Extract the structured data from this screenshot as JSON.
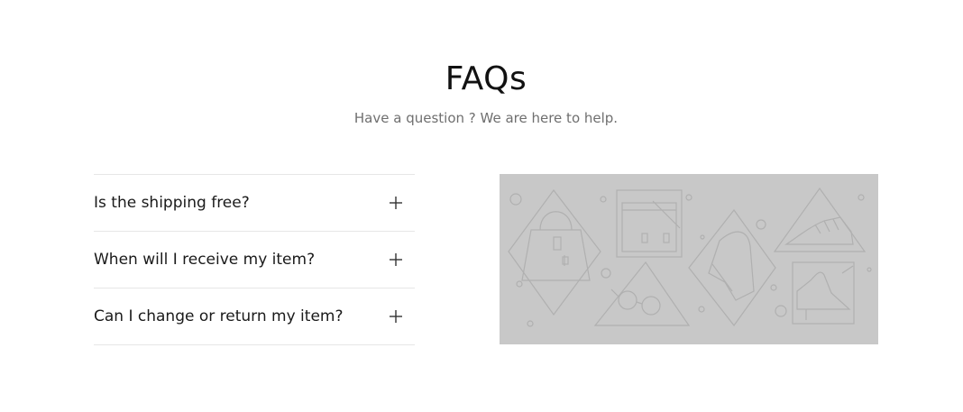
{
  "header": {
    "title": "FAQs",
    "subtitle": "Have a question ? We are here to help."
  },
  "faq": {
    "items": [
      {
        "question": "Is the shipping free?",
        "icon": "plus-icon"
      },
      {
        "question": "When will I receive my item?",
        "icon": "plus-icon"
      },
      {
        "question": "Can I change or return my item?",
        "icon": "plus-icon"
      }
    ]
  },
  "illustration": {
    "background": "#c8c8c8",
    "line_color": "#b3b3b3"
  }
}
